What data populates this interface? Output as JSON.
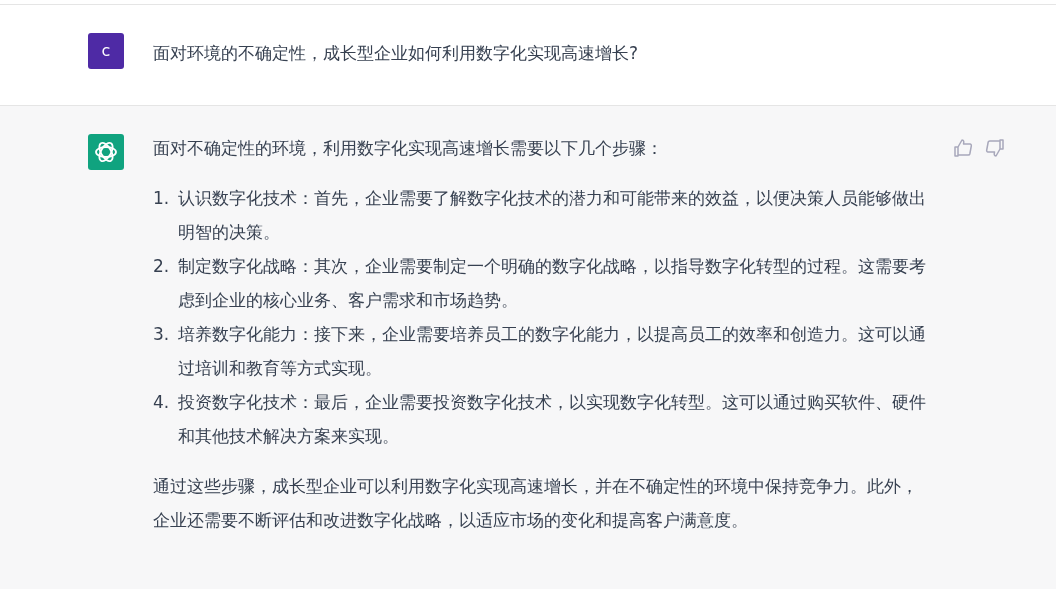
{
  "user_message": {
    "avatar": "c",
    "text": "面对环境的不确定性，成长型企业如何利用数字化实现高速增长?"
  },
  "assistant_message": {
    "intro": "面对不确定性的环境，利用数字化实现高速增长需要以下几个步骤：",
    "steps": [
      {
        "number": "1.",
        "text": "认识数字化技术：首先，企业需要了解数字化技术的潜力和可能带来的效益，以便决策人员能够做出明智的决策。"
      },
      {
        "number": "2.",
        "text": "制定数字化战略：其次，企业需要制定一个明确的数字化战略，以指导数字化转型的过程。这需要考虑到企业的核心业务、客户需求和市场趋势。"
      },
      {
        "number": "3.",
        "text": "培养数字化能力：接下来，企业需要培养员工的数字化能力，以提高员工的效率和创造力。这可以通过培训和教育等方式实现。"
      },
      {
        "number": "4.",
        "text": "投资数字化技术：最后，企业需要投资数字化技术，以实现数字化转型。这可以通过购买软件、硬件和其他技术解决方案来实现。"
      }
    ],
    "conclusion": "通过这些步骤，成长型企业可以利用数字化实现高速增长，并在不确定性的环境中保持竞争力。此外，企业还需要不断评估和改进数字化战略，以适应市场的变化和提高客户满意度。"
  }
}
